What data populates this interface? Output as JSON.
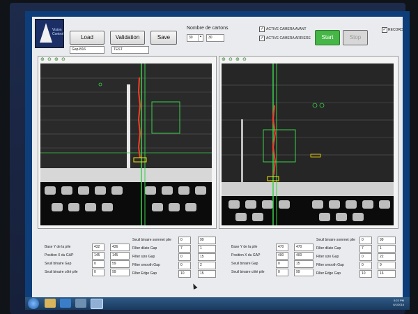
{
  "logo": {
    "text": "Vision Control"
  },
  "toolbar": {
    "load": "Load",
    "validation": "Validation",
    "save": "Save",
    "start": "Start",
    "stop": "Stop"
  },
  "fields": {
    "left_name": "Gap-B16",
    "right_name": "TEST"
  },
  "cartons": {
    "title": "Nombre de cartons",
    "value1": "30",
    "value2": "30"
  },
  "checks": {
    "camera_avant": "ACTIVE CAMERA AVANT",
    "camera_arriere": "ACTIVE CAMERA ARRIERE",
    "record": "RECORD"
  },
  "left_params": {
    "a": [
      {
        "label": "Base Y de la pile",
        "v1": "432",
        "v2": "436"
      },
      {
        "label": "Position X du GAP",
        "v1": "145",
        "v2": "145"
      },
      {
        "label": "Seuil binaire Gap",
        "v1": "0",
        "v2": "59"
      },
      {
        "label": "Seuil binaire côté pile",
        "v1": "0",
        "v2": "99"
      }
    ],
    "b": [
      {
        "label": "Seuil binaire sommet pile",
        "v1": "0",
        "v2": "99"
      },
      {
        "label": "Filter dilate Gap",
        "v1": "7",
        "v2": "1"
      },
      {
        "label": "Filter size Gap",
        "v1": "0",
        "v2": "15"
      },
      {
        "label": "Filter smooth Gap",
        "v1": "0",
        "v2": "2"
      },
      {
        "label": "Filter Edge Gap",
        "v1": "10",
        "v2": "15"
      }
    ]
  },
  "right_params": {
    "a": [
      {
        "label": "Base Y de la pile",
        "v1": "470",
        "v2": "470"
      },
      {
        "label": "Position X du GAP",
        "v1": "400",
        "v2": "400"
      },
      {
        "label": "Seuil binaire Gap",
        "v1": "0",
        "v2": "15"
      },
      {
        "label": "Seuil binaire côté pile",
        "v1": "0",
        "v2": "99"
      }
    ],
    "b": [
      {
        "label": "Seuil binaire sommet pile",
        "v1": "0",
        "v2": "99"
      },
      {
        "label": "Filter dilate Gap",
        "v1": "7",
        "v2": "1"
      },
      {
        "label": "Filter size Gap",
        "v1": "0",
        "v2": "22"
      },
      {
        "label": "Filter smooth Gap",
        "v1": "0",
        "v2": "9"
      },
      {
        "label": "Filter Edge Gap",
        "v1": "10",
        "v2": "16"
      }
    ]
  },
  "clock": {
    "time": "5:22 PM",
    "date": "6/1/2016"
  },
  "colors": {
    "start": "#3fae3f",
    "overlay_green": "#39d24a",
    "overlay_red": "#ff3a2a"
  }
}
